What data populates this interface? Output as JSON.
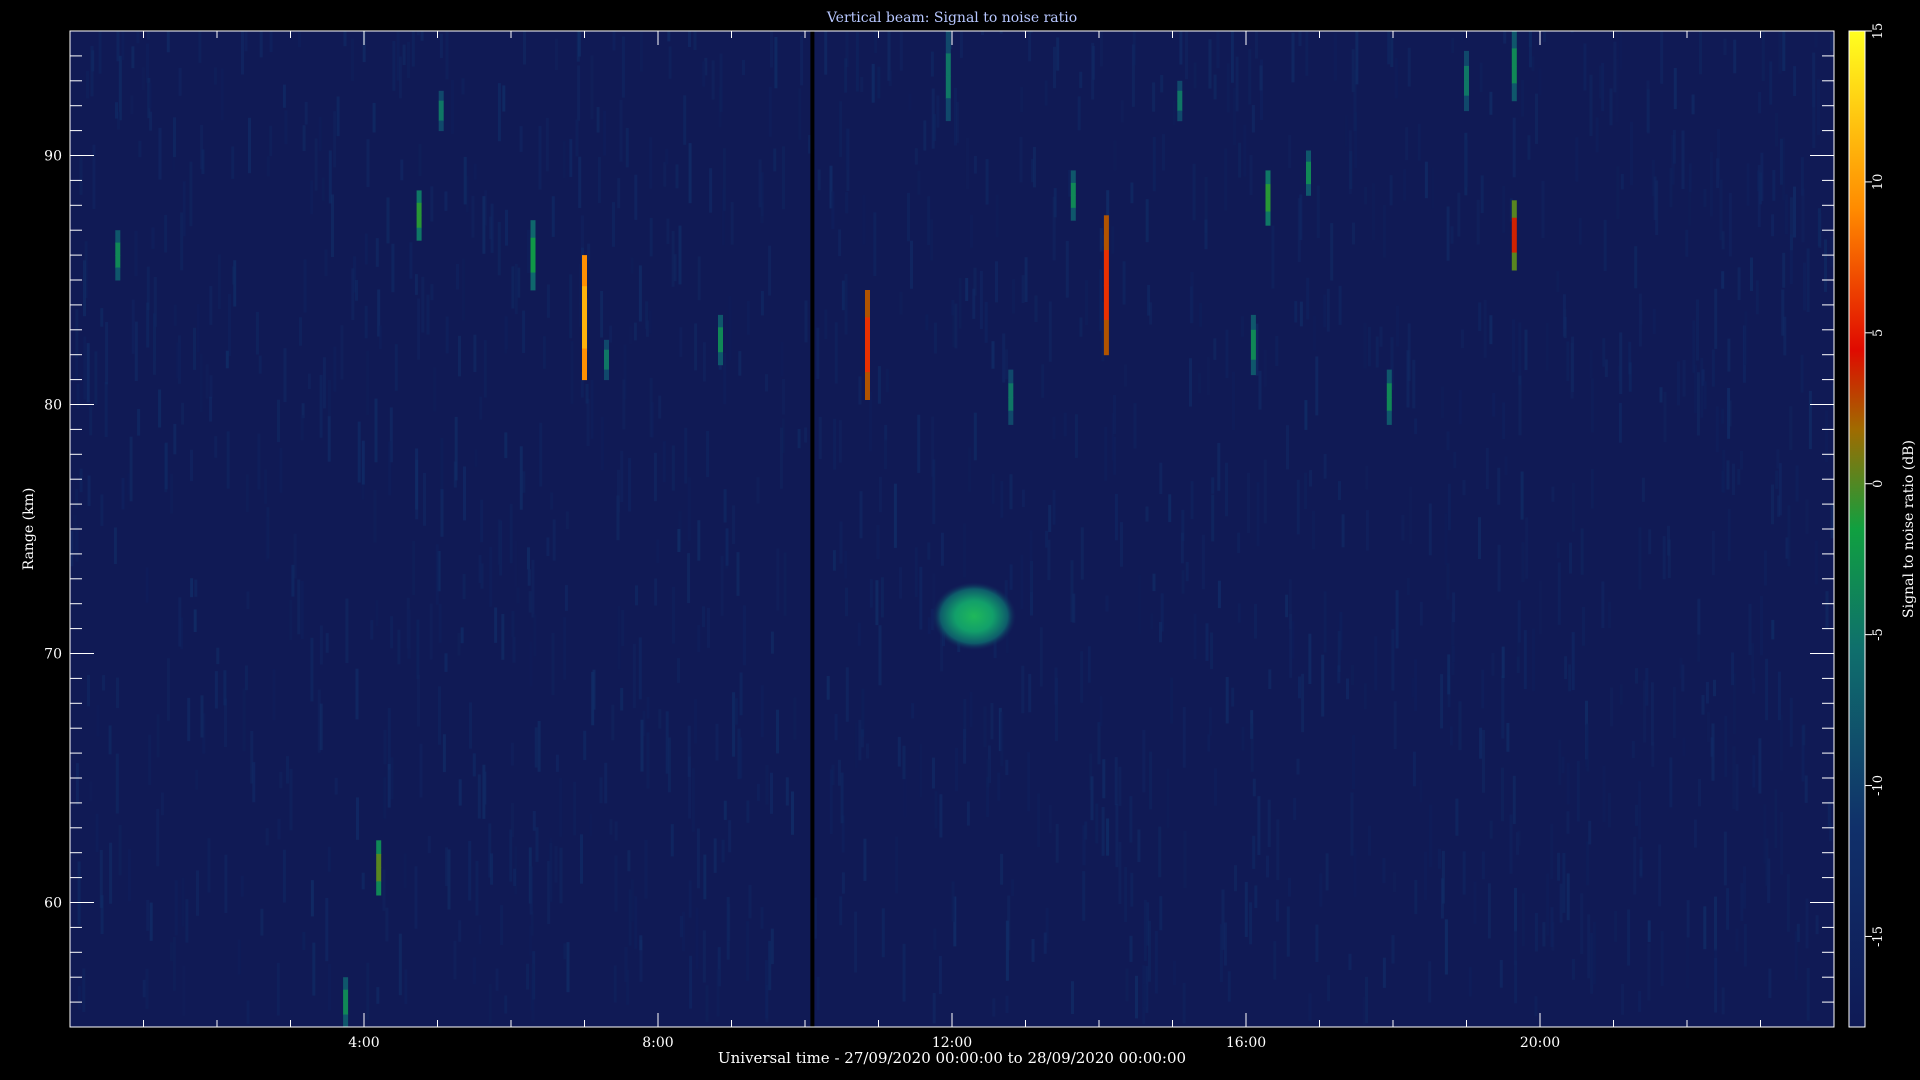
{
  "chart_data": {
    "type": "heatmap",
    "title": "Vertical beam: Signal to noise ratio",
    "xlabel": "Universal time - 27/09/2020 00:00:00 to 28/09/2020 00:00:00",
    "ylabel": "Range (km)",
    "colorbar_label": "Signal to noise ratio (dB)",
    "x_ticks": [
      {
        "hour": 4,
        "label": "4:00"
      },
      {
        "hour": 8,
        "label": "8:00"
      },
      {
        "hour": 12,
        "label": "12:00"
      },
      {
        "hour": 16,
        "label": "16:00"
      },
      {
        "hour": 20,
        "label": "20:00"
      }
    ],
    "y_ticks": [
      60,
      70,
      80,
      90
    ],
    "xlim_hours": [
      0,
      24
    ],
    "ylim_km": [
      55,
      95
    ],
    "colorbar_ticks": [
      15,
      10,
      5,
      0,
      -5,
      -10,
      -15
    ],
    "colorbar_range_db": [
      -18,
      15
    ],
    "background_level_db": -15,
    "data_gap_hour": 10.1,
    "features": [
      {
        "hour": 0.65,
        "range_from": 85,
        "range_to": 87,
        "snr": -5
      },
      {
        "hour": 3.75,
        "range_from": 55,
        "range_to": 57,
        "snr": -5
      },
      {
        "hour": 4.2,
        "range_from": 60.3,
        "range_to": 62.5,
        "snr": -2
      },
      {
        "hour": 4.75,
        "range_from": 86.6,
        "range_to": 88.6,
        "snr": -3
      },
      {
        "hour": 5.05,
        "range_from": 91,
        "range_to": 92.6,
        "snr": -6
      },
      {
        "hour": 6.3,
        "range_from": 84.6,
        "range_to": 87.4,
        "snr": -4
      },
      {
        "hour": 7.0,
        "range_from": 81,
        "range_to": 86,
        "snr": 10
      },
      {
        "hour": 7.3,
        "range_from": 81,
        "range_to": 82.6,
        "snr": -6
      },
      {
        "hour": 8.85,
        "range_from": 81.6,
        "range_to": 83.6,
        "snr": -5
      },
      {
        "hour": 10.85,
        "range_from": 80.2,
        "range_to": 84.6,
        "snr": 3
      },
      {
        "hour": 11.95,
        "range_from": 91.4,
        "range_to": 95,
        "snr": -6
      },
      {
        "hour": 12.8,
        "range_from": 79.2,
        "range_to": 81.4,
        "snr": -6
      },
      {
        "hour": 13.65,
        "range_from": 87.4,
        "range_to": 89.4,
        "snr": -5
      },
      {
        "hour": 14.1,
        "range_from": 82,
        "range_to": 87.6,
        "snr": 3
      },
      {
        "hour": 15.1,
        "range_from": 91.4,
        "range_to": 93,
        "snr": -6
      },
      {
        "hour": 16.1,
        "range_from": 81.2,
        "range_to": 83.6,
        "snr": -5
      },
      {
        "hour": 16.3,
        "range_from": 87.2,
        "range_to": 89.4,
        "snr": -3
      },
      {
        "hour": 16.85,
        "range_from": 88.4,
        "range_to": 90.2,
        "snr": -5
      },
      {
        "hour": 17.95,
        "range_from": 79.2,
        "range_to": 81.4,
        "snr": -5
      },
      {
        "hour": 19.0,
        "range_from": 91.8,
        "range_to": 94.2,
        "snr": -6
      },
      {
        "hour": 19.65,
        "range_from": 85.4,
        "range_to": 88.2,
        "snr": 1
      },
      {
        "hour": 19.65,
        "range_from": 92.2,
        "range_to": 95,
        "snr": -5
      }
    ],
    "blob": {
      "hour": 12.3,
      "range_km": 71.5,
      "snr": -7
    }
  }
}
